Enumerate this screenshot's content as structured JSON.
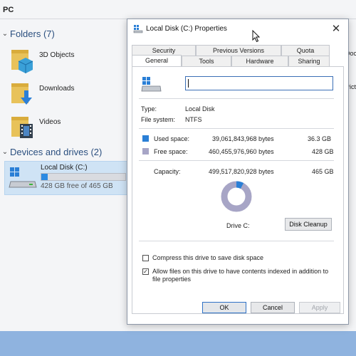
{
  "explorer": {
    "title": "PC",
    "folders_header": "Folders (7)",
    "folders": [
      {
        "label": "3D Objects",
        "icon": "3d-objects-folder-icon"
      },
      {
        "label": "Downloads",
        "icon": "downloads-folder-icon"
      },
      {
        "label": "Videos",
        "icon": "videos-folder-icon"
      }
    ],
    "devices_header": "Devices and drives (2)",
    "drive": {
      "name": "Local Disk (C:)",
      "free_text": "428 GB free of 465 GB",
      "used_fraction": 0.08
    },
    "right_labels": [
      "Doc",
      "Pict"
    ]
  },
  "dialog": {
    "title": "Local Disk (C:) Properties",
    "tabs_top": [
      "Security",
      "Previous Versions",
      "Quota"
    ],
    "tabs_bottom": [
      "General",
      "Tools",
      "Hardware",
      "Sharing"
    ],
    "active_tab": "General",
    "name_value": "",
    "type_label": "Type:",
    "type_value": "Local Disk",
    "fs_label": "File system:",
    "fs_value": "NTFS",
    "used": {
      "label": "Used space:",
      "bytes": "39,061,843,968 bytes",
      "size": "36.3 GB"
    },
    "free": {
      "label": "Free space:",
      "bytes": "460,455,976,960 bytes",
      "size": "428 GB"
    },
    "capacity": {
      "label": "Capacity:",
      "bytes": "499,517,820,928 bytes",
      "size": "465 GB"
    },
    "drive_label": "Drive C:",
    "used_fraction": 0.078,
    "cleanup_button": "Disk Cleanup",
    "compress_label": "Compress this drive to save disk space",
    "compress_checked": false,
    "index_label": "Allow files on this drive to have contents indexed in addition to file properties",
    "index_checked": true,
    "buttons": {
      "ok": "OK",
      "cancel": "Cancel",
      "apply": "Apply"
    }
  },
  "colors": {
    "used": "#2a7fd6",
    "free": "#a7a5c6",
    "accent": "#2f72c6",
    "taskbar": "#8fb3df"
  }
}
